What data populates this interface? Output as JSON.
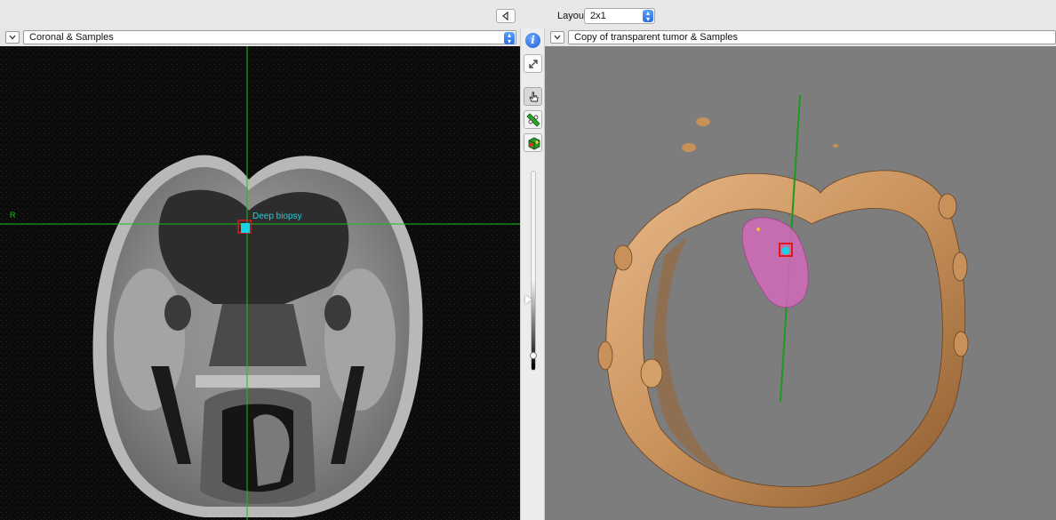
{
  "topbar": {
    "layout_label": "Layout:",
    "layout_value": "2x1"
  },
  "left_view": {
    "title": "Coronal & Samples",
    "orientation_label": "R",
    "marker_label": "Deep biopsy"
  },
  "right_view": {
    "title": "Copy of transparent tumor & Samples"
  },
  "toolbar": {
    "info_glyph": "i",
    "icons": [
      "info-icon",
      "expand-icon",
      "hand-pointer-icon",
      "ruler-icon",
      "cube-icon"
    ]
  },
  "colors": {
    "crosshair": "#17c417",
    "marker_fill": "#1fd0e0",
    "marker_border": "#e01818",
    "skull": "#c8915a",
    "tumor": "#d268b8",
    "view_bg_3d": "#7d7d7d"
  }
}
